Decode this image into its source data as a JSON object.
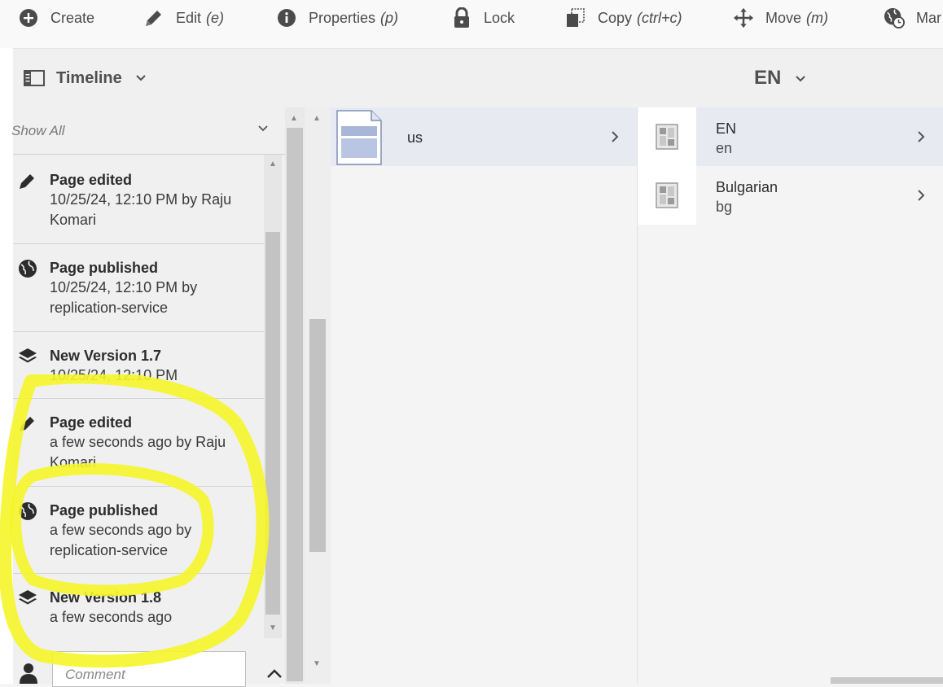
{
  "toolbar": {
    "create": "Create",
    "edit": "Edit",
    "edit_shortcut": "(e)",
    "properties": "Properties",
    "properties_shortcut": "(p)",
    "lock": "Lock",
    "copy": "Copy",
    "copy_shortcut": "(ctrl+c)",
    "move": "Move",
    "move_shortcut": "(m)",
    "manage": "Mar"
  },
  "rail": {
    "title": "Timeline",
    "filter": "Show All",
    "comment_placeholder": "Comment",
    "events": [
      {
        "icon": "pencil-icon",
        "title": "Page edited",
        "line1": "10/25/24, 12:10 PM by Raju",
        "line2": "Komari"
      },
      {
        "icon": "globe-icon",
        "title": "Page published",
        "line1": "10/25/24, 12:10 PM by",
        "line2": "replication-service"
      },
      {
        "icon": "layers-icon",
        "title": "New Version 1.7",
        "line1": "10/25/24, 12:10 PM",
        "line2": ""
      },
      {
        "icon": "pencil-icon",
        "title": "Page edited",
        "line1": "a few seconds ago by Raju",
        "line2": "Komari"
      },
      {
        "icon": "globe-icon",
        "title": "Page published",
        "line1": "a few seconds ago by",
        "line2": "replication-service"
      },
      {
        "icon": "layers-icon",
        "title": "New Version 1.8",
        "line1": "a few seconds ago",
        "line2": ""
      }
    ]
  },
  "browser": {
    "column_title": "EN",
    "col1": [
      {
        "title": "us"
      }
    ],
    "col2": [
      {
        "title": "EN",
        "sub": "en"
      },
      {
        "title": "Bulgarian",
        "sub": "bg"
      }
    ]
  },
  "colors": {
    "annotation": "#f5f52a",
    "selected_row": "#e8eaf2"
  }
}
